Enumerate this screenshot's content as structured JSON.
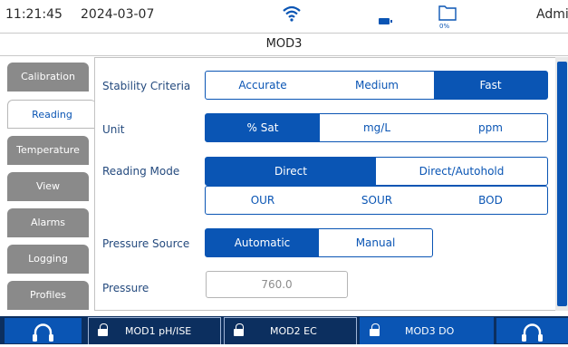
{
  "status": {
    "time": "11:21:45",
    "date": "2024-03-07",
    "icons": [
      "wifi-icon",
      "battery-icon",
      "folder-icon"
    ],
    "storage_percent": "0%",
    "user": "Admin"
  },
  "title": "MOD3",
  "sidebar": {
    "tabs": [
      {
        "label": "Calibration"
      },
      {
        "label": "Reading"
      },
      {
        "label": "Temperature"
      },
      {
        "label": "View"
      },
      {
        "label": "Alarms"
      },
      {
        "label": "Logging"
      },
      {
        "label": "Profiles"
      }
    ],
    "active": "Reading"
  },
  "settings": {
    "stability": {
      "label": "Stability Criteria",
      "options": [
        "Accurate",
        "Medium",
        "Fast"
      ],
      "selected": "Fast"
    },
    "unit": {
      "label": "Unit",
      "options": [
        "% Sat",
        "mg/L",
        "ppm"
      ],
      "selected": "% Sat"
    },
    "reading_mode": {
      "label": "Reading Mode",
      "options_row1": [
        "Direct",
        "Direct/Autohold"
      ],
      "options_row2": [
        "OUR",
        "SOUR",
        "BOD"
      ],
      "selected": "Direct"
    },
    "pressure_source": {
      "label": "Pressure Source",
      "options": [
        "Automatic",
        "Manual"
      ],
      "selected": "Automatic"
    },
    "pressure": {
      "label": "Pressure",
      "value": "760.0"
    }
  },
  "modules": [
    {
      "label": "MOD1 pH/ISE"
    },
    {
      "label": "MOD2 EC"
    },
    {
      "label": "MOD3 DO"
    }
  ],
  "active_module": "MOD3 DO",
  "colors": {
    "accent": "#0a55b4",
    "bottom_bar": "#0c2f5f",
    "tab_inactive": "#8a8a8a",
    "label": "#244a7e"
  }
}
